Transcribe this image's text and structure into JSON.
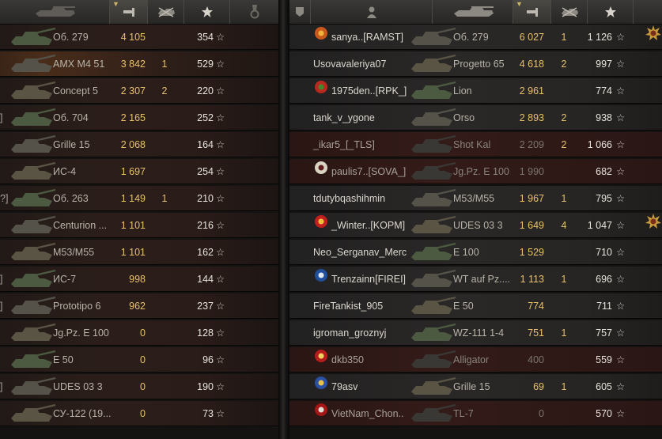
{
  "colors": {
    "damage": "#e9c16a",
    "kills": "#e2c06f",
    "xp": "#e8e4dc",
    "player": "#dcd8cf"
  },
  "header": {
    "left_columns": [
      "tank-icon",
      "damage-icon",
      "kills-icon",
      "star-icon",
      "medal-icon"
    ],
    "right_columns": [
      "badge-icon",
      "player-icon",
      "tank-icon",
      "damage-icon",
      "kills-icon",
      "star-icon"
    ],
    "sort_indicator": "▼"
  },
  "left_team": [
    {
      "edge": "",
      "vehicle": "Об. 279",
      "damage": "4 105",
      "kills": "",
      "xp": "354",
      "dead": false,
      "hl": false
    },
    {
      "edge": "",
      "vehicle": "AMX M4 51",
      "damage": "3 842",
      "kills": "1",
      "xp": "529",
      "dead": false,
      "hl": true
    },
    {
      "edge": "",
      "vehicle": "Concept 5",
      "damage": "2 307",
      "kills": "2",
      "xp": "220",
      "dead": false,
      "hl": false
    },
    {
      "edge": "]",
      "vehicle": "Об. 704",
      "damage": "2 165",
      "kills": "",
      "xp": "252",
      "dead": false,
      "hl": false
    },
    {
      "edge": "",
      "vehicle": "Grille 15",
      "damage": "2 068",
      "kills": "",
      "xp": "164",
      "dead": false,
      "hl": false
    },
    {
      "edge": "",
      "vehicle": "ИС-4",
      "damage": "1 697",
      "kills": "",
      "xp": "254",
      "dead": false,
      "hl": false
    },
    {
      "edge": "?]",
      "vehicle": "Об. 263",
      "damage": "1 149",
      "kills": "1",
      "xp": "210",
      "dead": false,
      "hl": false
    },
    {
      "edge": "",
      "vehicle": "Centurion ...",
      "damage": "1 101",
      "kills": "",
      "xp": "216",
      "dead": false,
      "hl": false
    },
    {
      "edge": "",
      "vehicle": "M53/M55",
      "damage": "1 101",
      "kills": "",
      "xp": "162",
      "dead": false,
      "hl": false
    },
    {
      "edge": "]",
      "vehicle": "ИС-7",
      "damage": "998",
      "kills": "",
      "xp": "144",
      "dead": false,
      "hl": false
    },
    {
      "edge": "]",
      "vehicle": "Prototipo 6",
      "damage": "962",
      "kills": "",
      "xp": "237",
      "dead": false,
      "hl": false
    },
    {
      "edge": "",
      "vehicle": "Jg.Pz. E 100",
      "damage": "0",
      "kills": "",
      "xp": "128",
      "dead": false,
      "hl": false
    },
    {
      "edge": "",
      "vehicle": "E 50",
      "damage": "0",
      "kills": "",
      "xp": "96",
      "dead": false,
      "hl": false
    },
    {
      "edge": "]",
      "vehicle": "UDES 03 3",
      "damage": "0",
      "kills": "",
      "xp": "190",
      "dead": false,
      "hl": false
    },
    {
      "edge": "",
      "vehicle": "СУ-122 (19...",
      "damage": "0",
      "kills": "",
      "xp": "73",
      "dead": false,
      "hl": false
    }
  ],
  "right_team": [
    {
      "badge": "orange",
      "player": "sanya..[RAMST]",
      "vehicle": "Об. 279",
      "damage": "6 027",
      "kills": "1",
      "xp": "1 126",
      "dead": false,
      "medal": true
    },
    {
      "badge": "",
      "player": "Usovavaleriya07",
      "vehicle": "Progetto 65",
      "damage": "4 618",
      "kills": "2",
      "xp": "997",
      "dead": false,
      "medal": false
    },
    {
      "badge": "red-green",
      "player": "1975den..[RPK_]",
      "vehicle": "Lion",
      "damage": "2 961",
      "kills": "",
      "xp": "774",
      "dead": false,
      "medal": false
    },
    {
      "badge": "",
      "player": "tank_v_ygone",
      "vehicle": "Orso",
      "damage": "2 893",
      "kills": "2",
      "xp": "938",
      "dead": false,
      "medal": false
    },
    {
      "badge": "",
      "player": "_ikar5_[_TLS]",
      "vehicle": "Shot Kal",
      "damage": "2 209",
      "kills": "2",
      "xp": "1 066",
      "dead": true,
      "medal": false
    },
    {
      "badge": "skull",
      "player": "paulis7..[SOVA_]",
      "vehicle": "Jg.Pz. E 100",
      "damage": "1 990",
      "kills": "",
      "xp": "682",
      "dead": true,
      "medal": false
    },
    {
      "badge": "",
      "player": "tdutybqashihmin",
      "vehicle": "M53/M55",
      "damage": "1 967",
      "kills": "1",
      "xp": "795",
      "dead": false,
      "medal": false
    },
    {
      "badge": "flag",
      "player": "_Winter..[KOPM]",
      "vehicle": "UDES 03 3",
      "damage": "1 649",
      "kills": "4",
      "xp": "1 047",
      "dead": false,
      "medal": true
    },
    {
      "badge": "",
      "player": "Neo_Serganav_Merc",
      "vehicle": "E 100",
      "damage": "1 529",
      "kills": "",
      "xp": "710",
      "dead": false,
      "medal": false
    },
    {
      "badge": "blue",
      "player": "Trenzainn[FIREI]",
      "vehicle": "WT auf Pz....",
      "damage": "1 113",
      "kills": "1",
      "xp": "696",
      "dead": false,
      "medal": false
    },
    {
      "badge": "",
      "player": "FireTankist_905",
      "vehicle": "E 50",
      "damage": "774",
      "kills": "",
      "xp": "711",
      "dead": false,
      "medal": false
    },
    {
      "badge": "",
      "player": "igroman_groznyj",
      "vehicle": "WZ-111 1-4",
      "damage": "751",
      "kills": "1",
      "xp": "757",
      "dead": false,
      "medal": false
    },
    {
      "badge": "red",
      "player": "dkb350",
      "vehicle": "Alligator",
      "damage": "400",
      "kills": "",
      "xp": "559",
      "dead": true,
      "medal": false
    },
    {
      "badge": "blue-gold",
      "player": "79asv",
      "vehicle": "Grille 15",
      "damage": "69",
      "kills": "1",
      "xp": "605",
      "dead": false,
      "medal": false
    },
    {
      "badge": "red-oval",
      "player": "VietNam_Chon..",
      "vehicle": "TL-7",
      "damage": "0",
      "kills": "",
      "xp": "570",
      "dead": true,
      "medal": false
    }
  ],
  "star_glyph": "☆"
}
